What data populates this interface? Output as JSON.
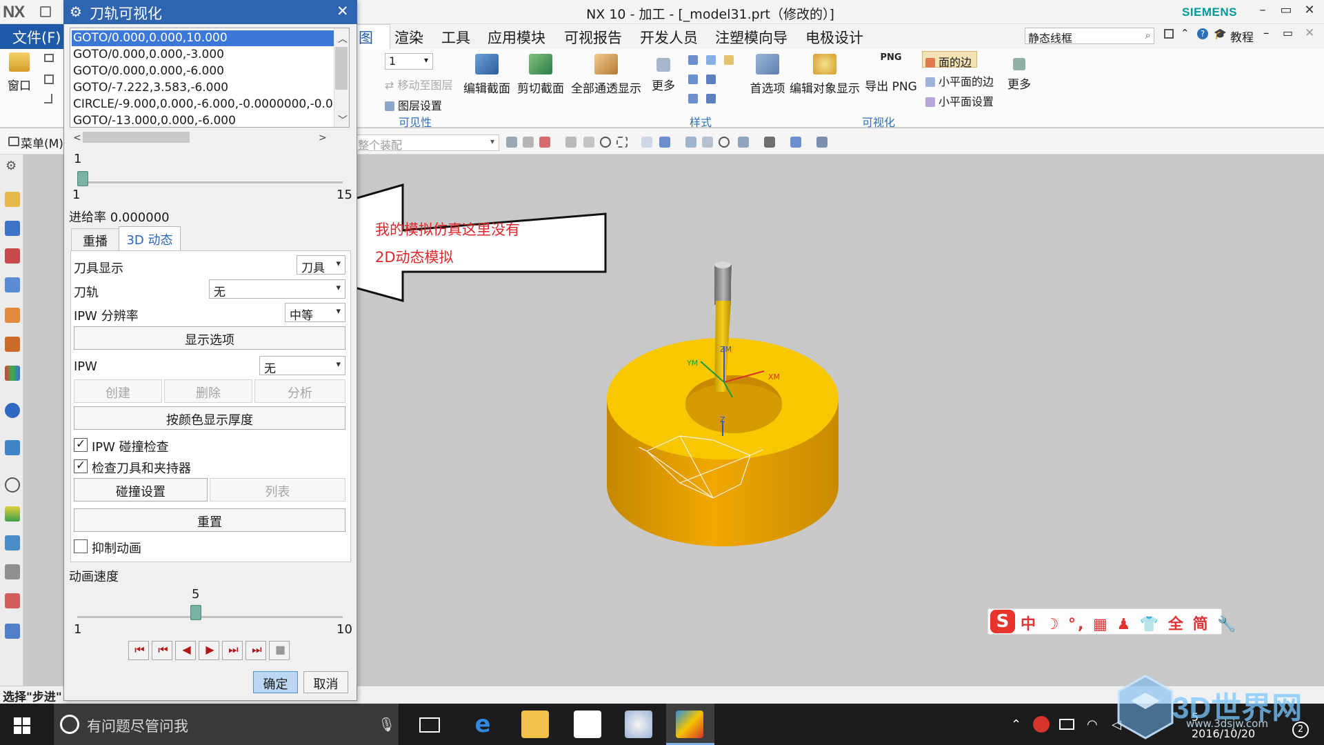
{
  "window": {
    "logo": "NX",
    "title": "NX 10 - 加工 - [_model31.prt（修改的）]",
    "brand": "SIEMENS",
    "controls": [
      "–",
      "▭",
      "✕"
    ]
  },
  "ribbon": {
    "file_tab": "文件(F)",
    "tabs": [
      "视图",
      "渲染",
      "工具",
      "应用模块",
      "可视报告",
      "开发人员",
      "注塑模向导",
      "电极设计"
    ],
    "active_tab_fragment": "图",
    "search_value": "静态线框",
    "help_label": "教程",
    "groups": {
      "window_label": "窗口",
      "number_input": "1",
      "move_to_layer": "移动至图层",
      "layer_settings": "图层设置",
      "visibility_group": "可见性",
      "edit_section": "编辑截面",
      "clip_section": "剪切截面",
      "show_all_through": "全部通透显示",
      "more_1": "更多",
      "style_group": "样式",
      "preferences": "首选项",
      "edit_object_display": "编辑对象显示",
      "export_png": "导出 PNG",
      "png_tag": "PNG",
      "face_edges": "面的边",
      "facet_edges": "小平面的边",
      "facet_settings": "小平面设置",
      "more_2": "更多",
      "visualization_group": "可视化"
    }
  },
  "cmdbar": {
    "menu": "菜单(M)",
    "assembly_select": "整个装配"
  },
  "status": {
    "text": "选择\"步进\""
  },
  "taskbar": {
    "cortana_text": "有问题尽管问我",
    "date": "2016/10/20",
    "time_fragment": "5"
  },
  "dialog": {
    "title": "刀轨可视化",
    "cl_list": [
      "GOTO/0.000,0.000,10.000",
      "GOTO/0.000,0.000,-3.000",
      "GOTO/0.000,0.000,-6.000",
      "GOTO/-7.222,3.583,-6.000",
      "CIRCLE/-9.000,0.000,-6.000,-0.0000000,-0.0",
      "GOTO/-13.000,0.000,-6.000"
    ],
    "selected_row": 0,
    "step_slider": {
      "value": "1",
      "min": "1",
      "max": "15",
      "level": 0.0
    },
    "feed_rate": "进给率 0.000000",
    "tabs": {
      "replay": "重播",
      "dynamic_3d": "3D 动态"
    },
    "tool_display": {
      "label": "刀具显示",
      "value": "刀具"
    },
    "tool_path": {
      "label": "刀轨",
      "value": "无"
    },
    "ipw_resolution": {
      "label": "IPW 分辨率",
      "value": "中等"
    },
    "display_options_btn": "显示选项",
    "ipw": {
      "label": "IPW",
      "value": "无"
    },
    "create_btn": "创建",
    "delete_btn": "删除",
    "analyze_btn": "分析",
    "color_thickness_btn": "按颜色显示厚度",
    "ipw_collision": {
      "label": "IPW 碰撞检查",
      "checked": "✓"
    },
    "check_tool_holder": {
      "label": "检查刀具和夹持器",
      "checked": "✓"
    },
    "collision_settings_btn": "碰撞设置",
    "list_btn": "列表",
    "reset_btn": "重置",
    "suppress_animation": {
      "label": "抑制动画",
      "checked": ""
    },
    "anim_speed_label": "动画速度",
    "speed_slider": {
      "value": "5",
      "min": "1",
      "max": "10",
      "level": 0.444
    },
    "playback": [
      "⏮",
      "⏮",
      "◀",
      "▶",
      "⏭",
      "⏭",
      "■"
    ],
    "ok": "确定",
    "cancel": "取消"
  },
  "annotation": {
    "line1": "我的模拟仿真这里没有",
    "line2": "2D动态模拟"
  },
  "viewport": {
    "axis_labels": {
      "zm": "ZM",
      "ym": "YM",
      "xm": "XM",
      "z": "Z"
    }
  },
  "ime": {
    "logo": "S",
    "text": "中 ☽ °, ▦ ♟ 👕 全 简 🔧"
  },
  "watermark": {
    "text": "3D世界网",
    "url": "www.3dsjw.com"
  },
  "colors": {
    "nx_blue": "#1e5aa8",
    "dialog_title": "#2f65b0",
    "part_yellow": "#f4c400",
    "annotation_red": "#e0262b"
  }
}
